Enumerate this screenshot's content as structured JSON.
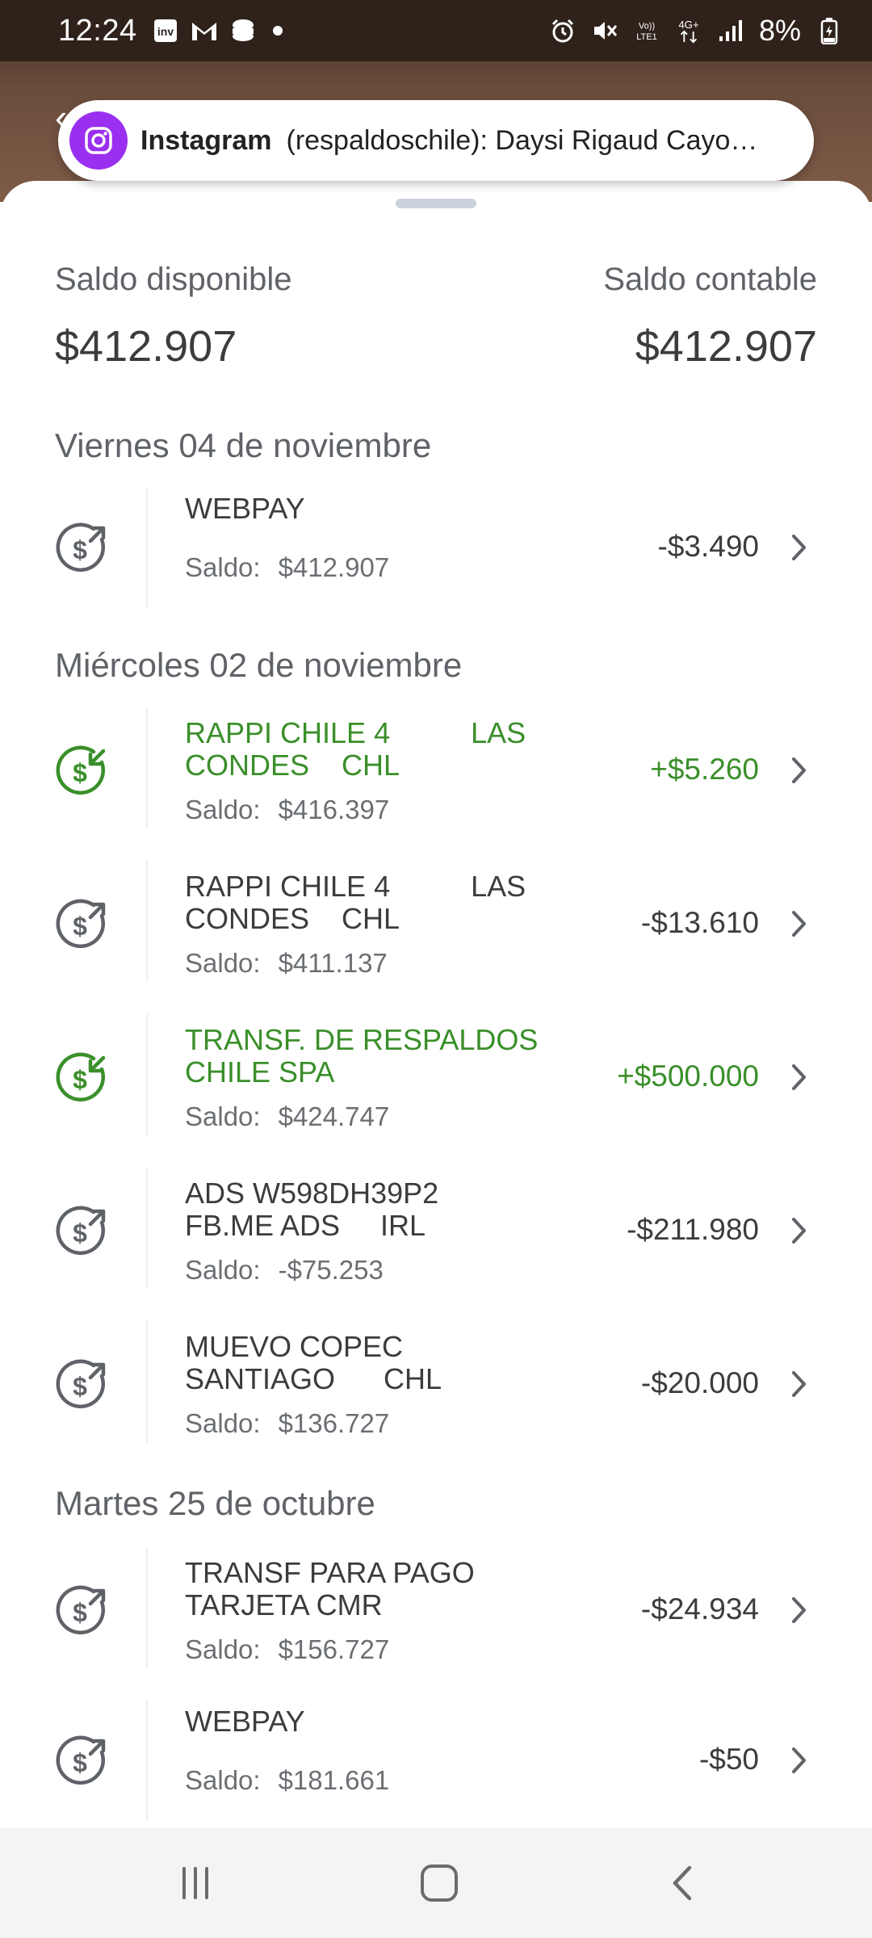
{
  "status_bar": {
    "time": "12:24",
    "left_icons": [
      "inv-app-icon",
      "gmail-icon",
      "burger-king-icon",
      "dot-icon"
    ],
    "right_icons": [
      "alarm-icon",
      "mute-icon",
      "volte-icon",
      "4g-icon",
      "signal-icon"
    ],
    "battery": "8%"
  },
  "notification": {
    "app": "Instagram",
    "text": "(respaldoschile): Daysi Rigaud Cayo…"
  },
  "balances": {
    "available_label": "Saldo disponible",
    "available_value": "$412.907",
    "accounting_label": "Saldo contable",
    "accounting_value": "$412.907"
  },
  "sections": [
    {
      "date": "Viernes 04 de noviembre",
      "transactions": [
        {
          "description": "WEBPAY",
          "saldo_label": "Saldo:",
          "saldo": "$412.907",
          "amount": "-$3.490",
          "type": "debit"
        }
      ]
    },
    {
      "date": "Miércoles 02 de noviembre",
      "transactions": [
        {
          "description": "RAPPI CHILE 4          LAS\nCONDES    CHL",
          "saldo_label": "Saldo:",
          "saldo": "$416.397",
          "amount": "+$5.260",
          "type": "credit"
        },
        {
          "description": "RAPPI CHILE 4          LAS\nCONDES    CHL",
          "saldo_label": "Saldo:",
          "saldo": "$411.137",
          "amount": "-$13.610",
          "type": "debit"
        },
        {
          "description": "TRANSF. DE RESPALDOS\nCHILE SPA",
          "saldo_label": "Saldo:",
          "saldo": "$424.747",
          "amount": "+$500.000",
          "type": "credit"
        },
        {
          "description": "ADS W598DH39P2\nFB.ME ADS     IRL",
          "saldo_label": "Saldo:",
          "saldo": "-$75.253",
          "amount": "-$211.980",
          "type": "debit"
        },
        {
          "description": "MUEVO COPEC\nSANTIAGO      CHL",
          "saldo_label": "Saldo:",
          "saldo": "$136.727",
          "amount": "-$20.000",
          "type": "debit"
        }
      ]
    },
    {
      "date": "Martes 25 de octubre",
      "transactions": [
        {
          "description": "TRANSF PARA PAGO\nTARJETA CMR",
          "saldo_label": "Saldo:",
          "saldo": "$156.727",
          "amount": "-$24.934",
          "type": "debit"
        },
        {
          "description": "WEBPAY",
          "saldo_label": "Saldo:",
          "saldo": "$181.661",
          "amount": "-$50",
          "type": "debit"
        }
      ]
    }
  ],
  "nav_bar": {
    "buttons": [
      "recent-apps-icon",
      "home-icon",
      "back-icon"
    ]
  },
  "colors": {
    "credit": "#3a8f2a",
    "debit_icon": "#5f6368",
    "notification_app": "#9a2ff0"
  }
}
